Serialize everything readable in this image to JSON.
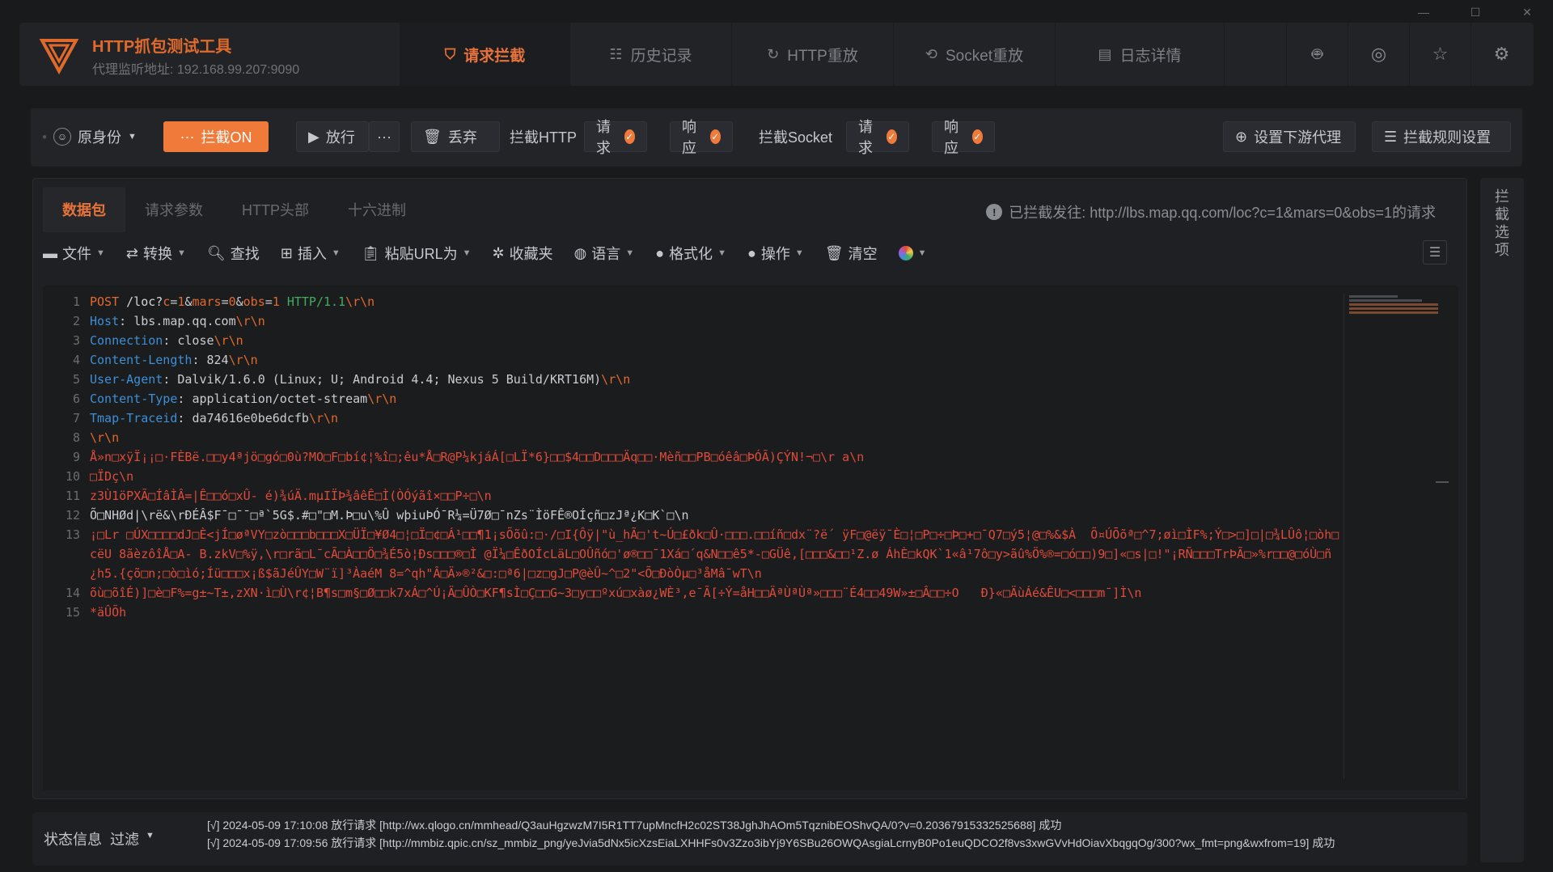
{
  "app": {
    "title": "HTTP抓包测试工具",
    "proxy_label": "代理监听地址:",
    "proxy_addr": "192.168.99.207:9090"
  },
  "nav": [
    {
      "label": "请求拦截",
      "icon": "intercept-icon",
      "active": true
    },
    {
      "label": "历史记录",
      "icon": "history-icon"
    },
    {
      "label": "HTTP重放",
      "icon": "replay-icon"
    },
    {
      "label": "Socket重放",
      "icon": "socket-replay-icon"
    },
    {
      "label": "日志详情",
      "icon": "log-icon"
    }
  ],
  "toolbar": {
    "identity": "原身份",
    "intercept": "拦截ON",
    "release": "放行",
    "more": "···",
    "discard": "丢弃",
    "intercept_http": "拦截HTTP",
    "req": "请求",
    "resp": "响应",
    "intercept_socket": "拦截Socket",
    "upstream": "设置下游代理",
    "rules": "拦截规则设置"
  },
  "subtabs": [
    {
      "label": "数据包",
      "active": true
    },
    {
      "label": "请求参数"
    },
    {
      "label": "HTTP头部"
    },
    {
      "label": "十六进制"
    }
  ],
  "notice": "已拦截发往: http://lbs.map.qq.com/loc?c=1&mars=0&obs=1的请求",
  "tools": {
    "file": "文件",
    "convert": "转换",
    "find": "查找",
    "insert": "插入",
    "paste_url": "粘贴URL为",
    "favorites": "收藏夹",
    "language": "语言",
    "format": "格式化",
    "operate": "操作",
    "clear": "清空"
  },
  "code": {
    "l1_method": "POST",
    "l1_url": "/loc?",
    "l1_c": "c",
    "l1_eq1": "=",
    "l1_v1": "1",
    "l1_amp1": "&",
    "l1_mars": "mars",
    "l1_eq2": "=",
    "l1_v2": "0",
    "l1_amp2": "&",
    "l1_obs": "obs",
    "l1_eq3": "=",
    "l1_v3": "1",
    "l1_proto": "HTTP/1.1",
    "crlf": "\\r\\n",
    "h2k": "Host",
    "h2v": "lbs.map.qq.com",
    "h3k": "Connection",
    "h3v": "close",
    "h4k": "Content-Length",
    "h4v": "824",
    "h5k": "User-Agent",
    "h5v": "Dalvik/1.6.0 (Linux; U; Android 4.4; Nexus 5 Build/KRT16M)",
    "h6k": "Content-Type",
    "h6v": "application/octet-stream",
    "h7k": "Tmap-Traceid",
    "h7v": "da74616e0be6dcfb",
    "b9": "Å»n□xÿÏ¡¡□·FÈBë.□□y4ªjö□gó□0ù?MO□F□bí¢¦%î□;êu*Å□R@P¼kjáÁ[□LÏ*6}□□$4□□D□□□Äq□□·Mèñ□□PB□óêâ□ÞÓÃ)ÇÝN!¬□\\r a\\n",
    "b10": "□ÏDç\\n",
    "b11": "z3Ù1öPXÃ□ÍâÌÂ=|Ê□□ó□xÛ- é)¾úÄ.mµIÏÞ¾âêÊ□Ì(ÒÓýãî×□□P÷□\\n",
    "b12": "Õ□NHØd|\\rë&\\rÐÉÂ$F¯□¯¯□ª`5G$.#□\"□M.Þ□u\\%Û wþiuÞÓ¯R¼=Ü7Ø□¯nZs¨ÌöFÊ®OÍçñ□zJª¿K□K`□\\n",
    "b13": "¡□Lr □ÚX□□□□dJ□È<jÍ□øªVY□zò□□□b□□□X□ÜÏ□¥Ø4□¦□Ï□¢□Á¹□□¶1¡sÕõû:□·/□I{Ôÿ|\"ù_hÃ□'t~Ú□£ðk□Û·□□□.□□íñ□dx¨?ë´ ÿF□@ëÿ¯È□¦□P□÷□Þ□+□¯Q7□ý5¦@□%&$À  Õ¤ÚŌõª□^7;øì□ÌF%;Ý□>□]□|□¾LÛô¦□òh□cëU 8ãèzôîÅ□A- B.zkV□%ÿ,\\r□rã□L¯cÃ□À□□Ö□¾É5ò¦Ðs□□□®□Ì @Ï¼□ÊðOÍcLäL□OÛñó□'ø®□□¯1Xá□´q&N□□ê5*-□GÜê,[□□□&□□¹Z.ø ÁhÈ□kQK`1«â¹7ô□y>ãû%Ö%®=□ó□□)9□]«□s|□!\"¡RÑ□□□TrÞÃ□»%r□□@□óÙ□ñ¿h5.{çõ□n;□ò□ìó;Íü□□□x¡ß$ãJéÛY□W¨ï]³ÀaéM 8=^qh\"Â□Ä»®²&□:□ª6|□z□gJ□P@èÛ~^□2\"<Õ□ÐòÒµ□³åMâ¯wT\\n",
    "b14": "õù□õîÉ)]□è□F%=g±~T±,zXN·ì□Ù\\r¢¦B¶s□m§□Ø□□k7xÁ□^Ú¡Ä□ÛÒ□KF¶sÌ□Ç□□G~3□y□□ºxú□xàø¿WÈ³,e¯Ã[÷Ý=åH□□ÄªÙªÙª»□□□¨É4□□49W»±□Â□□÷O   Ð}«□ÄùÁé&ÊU□<□□□m¯]Ì\\n",
    "b15": "*äÛÕh"
  },
  "right_panel_label": "拦截选项",
  "status": {
    "info": "状态信息",
    "filter": "过滤",
    "logs": [
      "[√] 2024-05-09 17:10:08 放行请求 [http://wx.qlogo.cn/mmhead/Q3auHgzwzM7I5R1TT7upMncfH2c02ST38JghJhAOm5TqznibEOShvQA/0?v=0.20367915332525688] 成功",
      "[√] 2024-05-09 17:09:56 放行请求 [http://mmbiz.qpic.cn/sz_mmbiz_png/yeJvia5dNx5icXzsEiaLXHHFs0v3Zzo3ibYj9Y6SBu26OWQAsgiaLcrnyB0Po1euQDCO2f8vs3xwGVvHdOiavXbqgqOg/300?wx_fmt=png&wxfrom=19] 成功"
    ]
  }
}
